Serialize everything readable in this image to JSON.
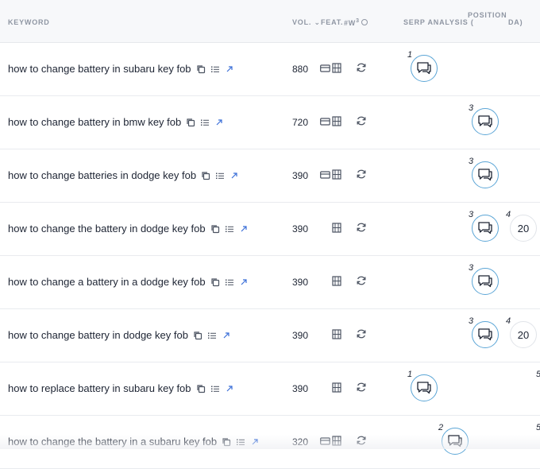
{
  "header": {
    "keyword": "KEYWORD",
    "vol": "VOL.",
    "feat": "FEAT.",
    "w": "#W",
    "w_sup": "3",
    "serp": "SERP ANALYSIS (",
    "position": "POSITION",
    "da": "DA)"
  },
  "rows": [
    {
      "keyword": "how to change battery in subaru key fob",
      "vol": "880",
      "rank": "1",
      "da": ""
    },
    {
      "keyword": "how to change battery in bmw key fob",
      "vol": "720",
      "rank": "3",
      "da": ""
    },
    {
      "keyword": "how to change batteries in dodge key fob",
      "vol": "390",
      "rank": "3",
      "da": ""
    },
    {
      "keyword": "how to change the battery in dodge key fob",
      "vol": "390",
      "rank": "3",
      "rank2": "4",
      "da": "20"
    },
    {
      "keyword": "how to change a battery in a dodge key fob",
      "vol": "390",
      "rank": "3",
      "da": ""
    },
    {
      "keyword": "how to change battery in dodge key fob",
      "vol": "390",
      "rank": "3",
      "rank2": "4",
      "da": "20"
    },
    {
      "keyword": "how to replace battery in subaru key fob",
      "vol": "390",
      "rank": "1",
      "rank3": "5",
      "da": ""
    },
    {
      "keyword": "how to change the battery in a subaru key fob",
      "vol": "320",
      "rank": "2",
      "rank3": "5",
      "da": ""
    }
  ],
  "colors": {
    "bubble_border": "#5aa5d6",
    "link": "#3b6fd8"
  }
}
